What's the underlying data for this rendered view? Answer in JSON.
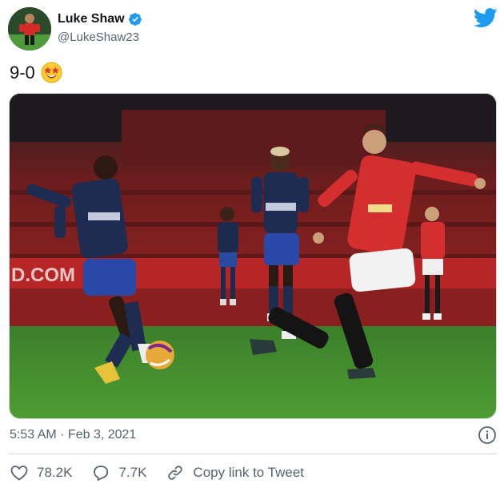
{
  "author": {
    "display_name": "Luke Shaw",
    "handle": "@LukeShaw23",
    "verified": true,
    "avatar_icon": "player-avatar",
    "verified_icon": "verified-badge-icon"
  },
  "brand": {
    "logo_icon": "twitter-bird-icon",
    "color": "#1d9bf0"
  },
  "tweet": {
    "text": "9-0",
    "emoji_icon": "star-struck-emoji",
    "media_description_icon": "football-match-photo"
  },
  "meta": {
    "timestamp": "5:53 AM · Feb 3, 2021",
    "info_icon": "info-icon"
  },
  "actions": {
    "like_count": "78.2K",
    "reply_count": "7.7K",
    "copy_link_label": "Copy link to Tweet",
    "like_icon": "heart-icon",
    "reply_icon": "reply-bubble-icon",
    "copy_icon": "link-icon"
  },
  "colors": {
    "text_primary": "#0f1419",
    "text_secondary": "#536471",
    "divider": "#cfd9de",
    "pitch": "#3f8a2c",
    "stands": "#8e1c1c"
  }
}
